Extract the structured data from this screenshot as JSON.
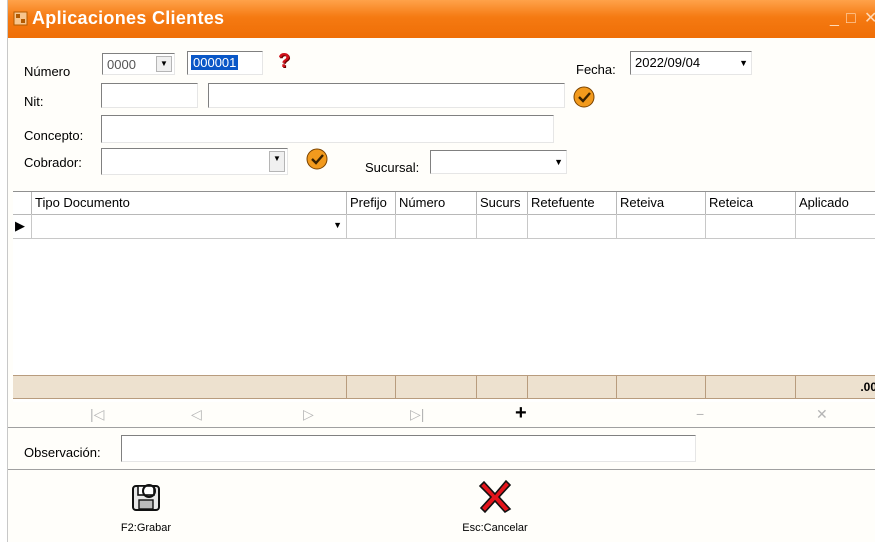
{
  "window": {
    "title": "Aplicaciones  Clientes",
    "minimize": "_",
    "maximize": "□",
    "close": "✕",
    "accent_color": "#f57a12"
  },
  "form": {
    "numero_label": "Número",
    "numero_prefix": "0000",
    "numero_value": "000001",
    "help_icon": "question-mark-icon",
    "fecha_label": "Fecha:",
    "fecha_value": "2022/09/04",
    "nit_label": "Nit:",
    "nit_code": "",
    "nit_name": "",
    "concepto_label": "Concepto:",
    "concepto_value": "",
    "cobrador_label": "Cobrador:",
    "cobrador_value": "",
    "sucursal_label": "Sucursal:",
    "sucursal_value": ""
  },
  "grid": {
    "columns": [
      "Tipo Documento",
      "Prefijo",
      "Número",
      "Sucurs",
      "Retefuente",
      "Reteiva",
      "Reteica",
      "Aplicado"
    ],
    "rows": [
      {
        "tipo_documento": "",
        "prefijo": "",
        "numero": "",
        "sucursal": "",
        "retefuente": "",
        "reteiva": "",
        "reteica": "",
        "aplicado": ""
      }
    ],
    "footer_total": ".00"
  },
  "navigator": {
    "first": "|◁",
    "prior": "◁",
    "next": "▷",
    "last": "▷|",
    "insert": "+",
    "delete": "−",
    "cancel": "✕"
  },
  "observacion": {
    "label": "Observación:",
    "value": ""
  },
  "actions": {
    "grabar_label": "F2:Grabar",
    "cancelar_label": "Esc:Cancelar"
  }
}
